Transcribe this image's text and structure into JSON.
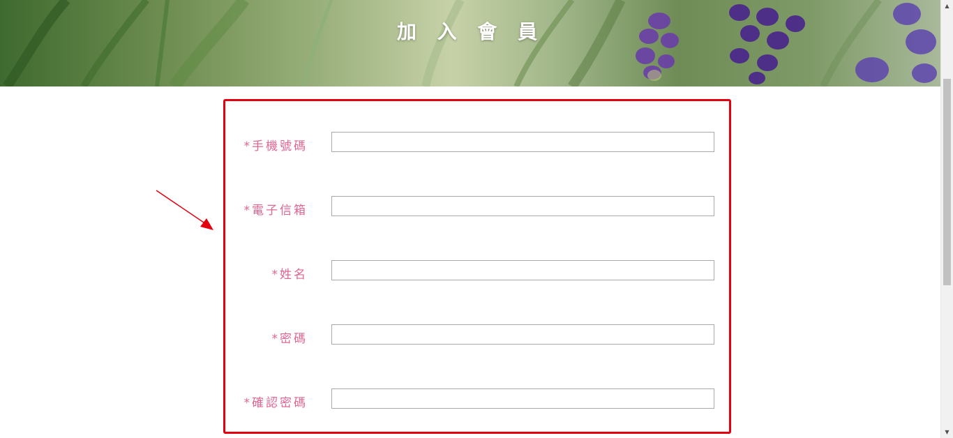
{
  "banner": {
    "title": "加 入 會 員"
  },
  "form": {
    "fields": [
      {
        "label": "*手機號碼",
        "value": "",
        "placeholder": ""
      },
      {
        "label": "*電子信箱",
        "value": "",
        "placeholder": ""
      },
      {
        "label": "*姓名",
        "value": "",
        "placeholder": ""
      },
      {
        "label": "*密碼",
        "value": "",
        "placeholder": ""
      },
      {
        "label": "*確認密碼",
        "value": "",
        "placeholder": ""
      }
    ]
  },
  "colors": {
    "label": "#e06592",
    "highlight": "#e3000f",
    "input_border": "#a9a9a9"
  },
  "icons": {
    "scroll_up": "triangle-up-icon",
    "scroll_down": "triangle-down-icon",
    "annotation": "arrow-icon"
  }
}
